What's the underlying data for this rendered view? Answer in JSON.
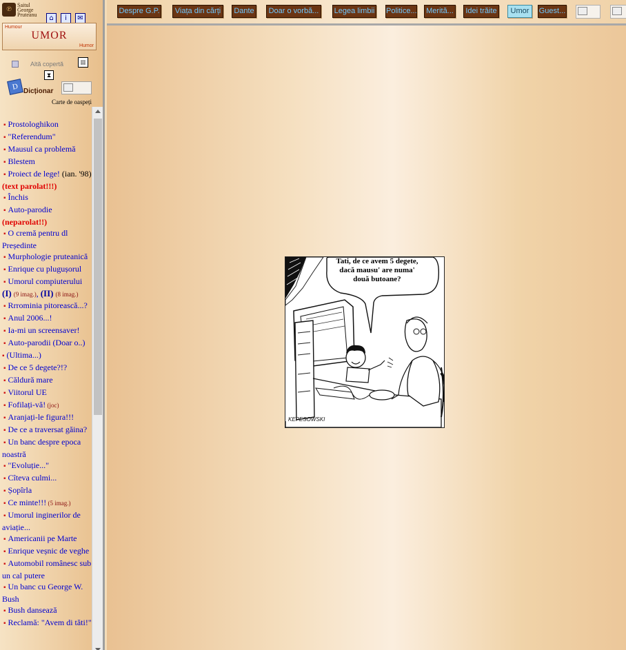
{
  "logo": {
    "line1": "Saitul",
    "line2": "George",
    "line3": "Pruteanu"
  },
  "top_icons": [
    "home-icon",
    "info-icon",
    "mail-icon",
    "help-icon"
  ],
  "umor_box": {
    "title": "UMOR",
    "top_left": "Humour",
    "bottom_right": "Humor"
  },
  "alt_cover": "Altă copertă",
  "dictionary": "Dicționar",
  "guestbook": "Carte de oaspeți",
  "nav_buttons": [
    {
      "label": "Despre G.P."
    },
    {
      "label": "Viața din cărți"
    },
    {
      "label": "Dante"
    },
    {
      "label": "Doar o vorbă..."
    },
    {
      "label": "Legea limbii"
    },
    {
      "label": "Politice..."
    },
    {
      "label": "Merită..."
    },
    {
      "label": "Idei trăite"
    },
    {
      "label": "Umor",
      "active": true
    },
    {
      "label": "Guest..."
    }
  ],
  "nav_items": [
    {
      "label": "Prostologhikon"
    },
    {
      "label": "\"Referendum\""
    },
    {
      "label": "Mausul ca problemă"
    },
    {
      "label": "Blestem"
    },
    {
      "label": "Proiect de lege!",
      "extra": " (ian. '98) ",
      "red": "(text parolat!!!)"
    },
    {
      "label": "Închis"
    },
    {
      "label": "Auto-parodie",
      "red": " (neparolat!!)"
    },
    {
      "label": "O cremă pentru dl Președinte"
    },
    {
      "label": "Murphologie pruteanică"
    },
    {
      "label": "Enrique cu plugușorul"
    },
    {
      "label": "Umorul compiuterului",
      "parts": [
        "(I)",
        "(9 imag.)",
        "(II)",
        "(8 imag.)"
      ]
    },
    {
      "label": "Rrrominia pitorească...?"
    },
    {
      "label": "Anul 2006...!"
    },
    {
      "label": "Ia-mi un screensaver!"
    },
    {
      "label": "Auto-parodii",
      "tail": [
        "(Doar o..)",
        "(Ultima...)"
      ]
    },
    {
      "label": "De ce 5 degete?!?"
    },
    {
      "label": "Căldură mare"
    },
    {
      "label": "Viitorul UE"
    },
    {
      "label": "Fofilați-vă!",
      "small": " (joc)"
    },
    {
      "label": "Aranjați-le figura!!!"
    },
    {
      "label": "De ce a traversat găina?"
    },
    {
      "label": "Un banc despre epoca noastră"
    },
    {
      "label": "\"Evoluție...\""
    },
    {
      "label": "Cîteva culmi..."
    },
    {
      "label": "Șopîrla"
    },
    {
      "label": "Ce minte!!!",
      "small": " (5 imag.)"
    },
    {
      "label": "Umorul inginerilor de aviație..."
    },
    {
      "label": "Americanii pe Marte"
    },
    {
      "label": "Enrique veșnic de veghe"
    },
    {
      "label": "Automobil românesc sub un cal putere"
    },
    {
      "label": "Un banc cu George W. Bush"
    },
    {
      "label": "Bush dansează"
    },
    {
      "label": "Reclamă: \"Avem di tăti!\""
    }
  ],
  "cartoon": {
    "speech": "Tati, de ce avem 5 degete, dacă mausu' are numa' două butoane?",
    "signature": "KEPESOWSKI"
  }
}
